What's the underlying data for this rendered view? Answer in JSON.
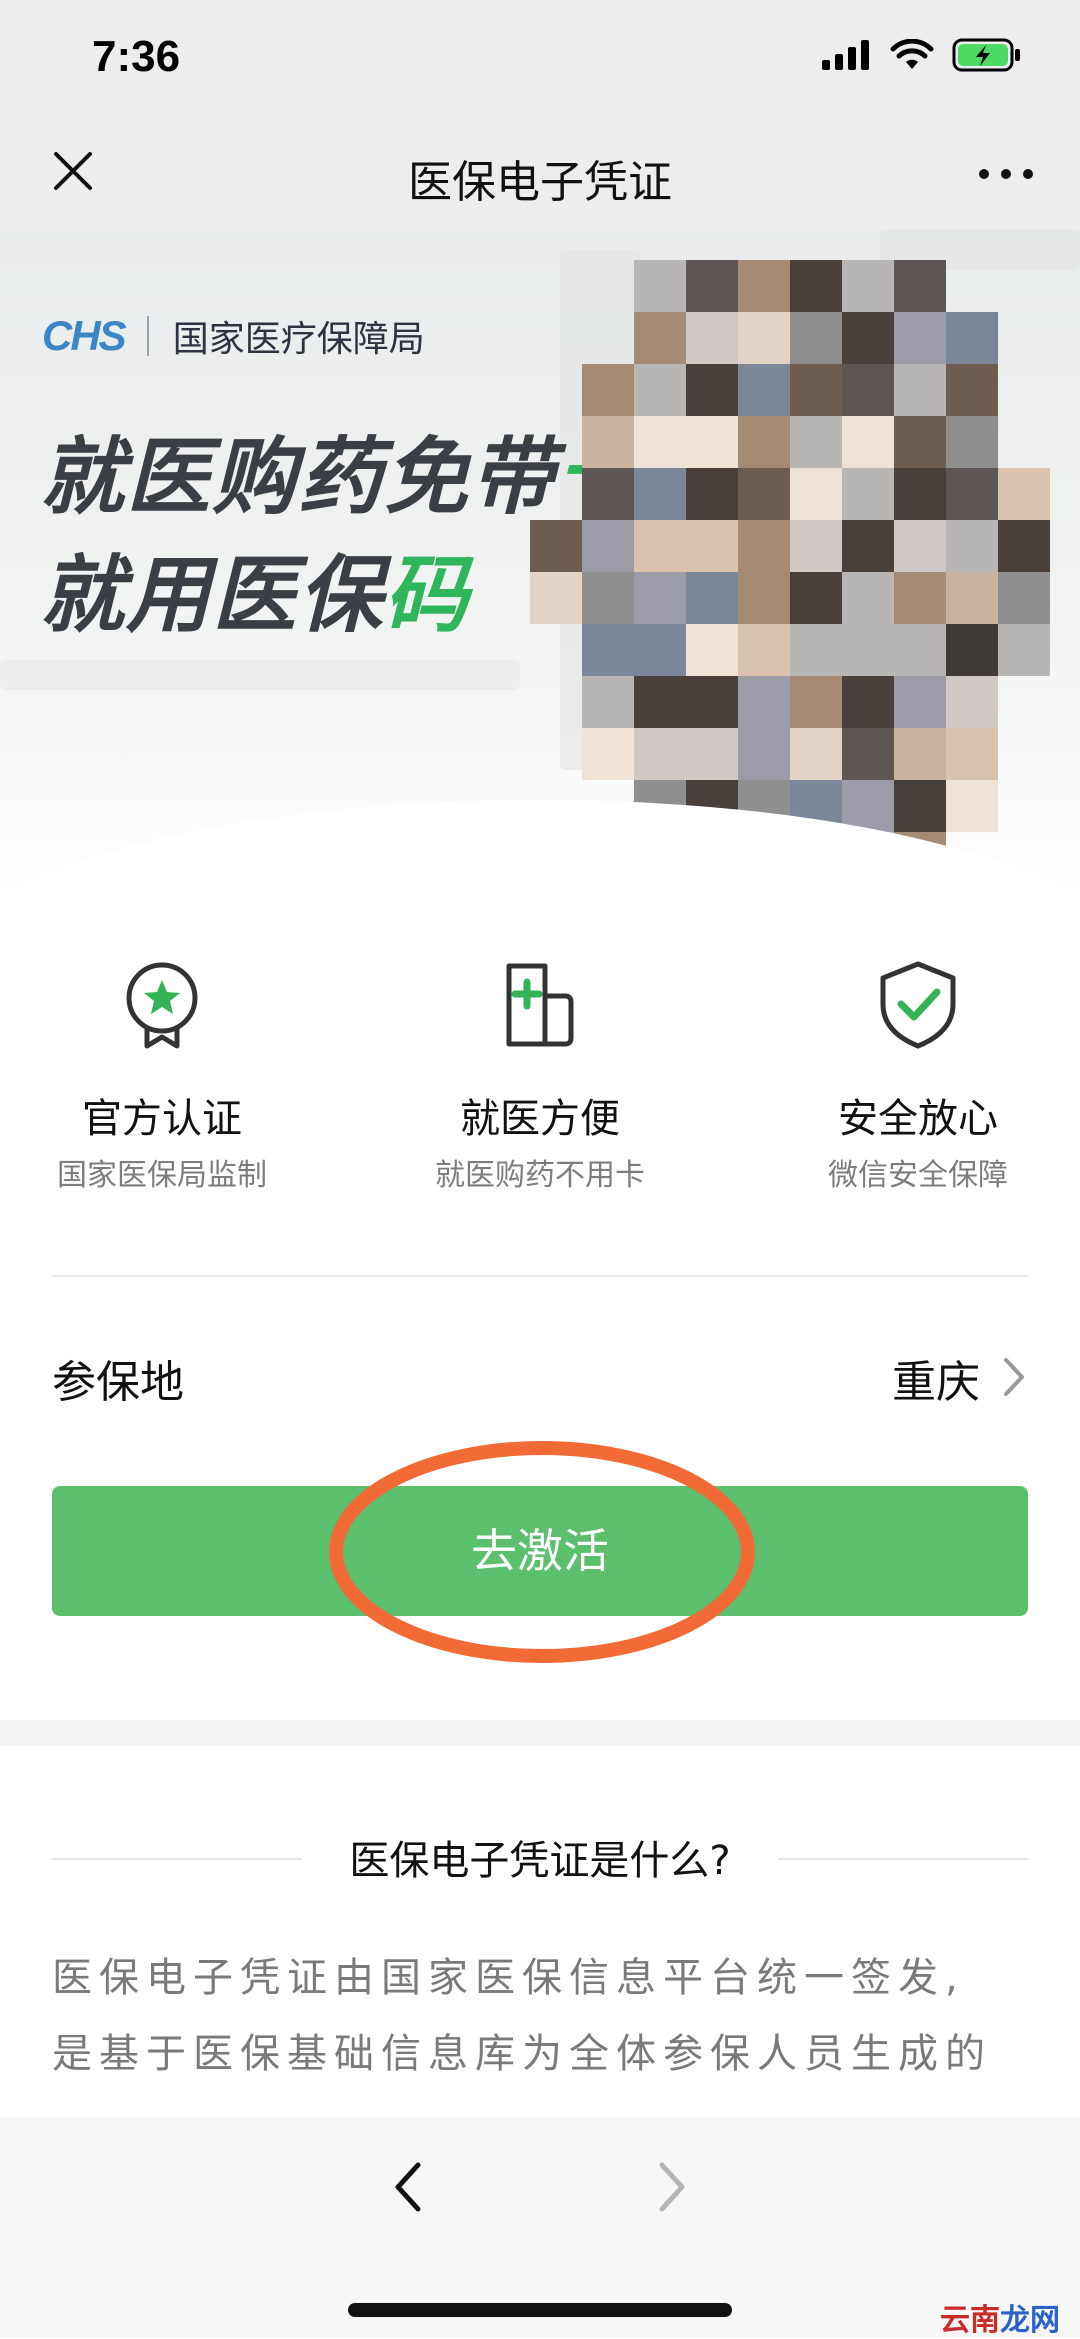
{
  "status_bar": {
    "time": "7:36"
  },
  "nav": {
    "title": "医保电子凭证"
  },
  "banner": {
    "logo_mark": "CHS",
    "logo_org": "国家医疗保障局",
    "slogan_line1_main": "就医购药免带",
    "slogan_line1_accent": "卡",
    "slogan_line2_main": "就用医保",
    "slogan_line2_accent": "码",
    "accent_color": "#2fb55a"
  },
  "features": [
    {
      "icon": "badge-star-icon",
      "title": "官方认证",
      "subtitle": "国家医保局监制"
    },
    {
      "icon": "medical-card-icon",
      "title": "就医方便",
      "subtitle": "就医购药不用卡"
    },
    {
      "icon": "shield-check-icon",
      "title": "安全放心",
      "subtitle": "微信安全保障"
    }
  ],
  "region": {
    "label": "参保地",
    "value": "重庆"
  },
  "activate_button": {
    "label": "去激活",
    "color": "#5bbf6e"
  },
  "annotation": {
    "color": "#f26b36"
  },
  "info": {
    "heading": "医保电子凭证是什么?",
    "line1": "医保电子凭证由国家医保信息平台统一签发,",
    "line2": "是基于医保基础信息库为全体参保人员生成的"
  },
  "watermark": {
    "part1": "云南",
    "part2": "龙网"
  }
}
